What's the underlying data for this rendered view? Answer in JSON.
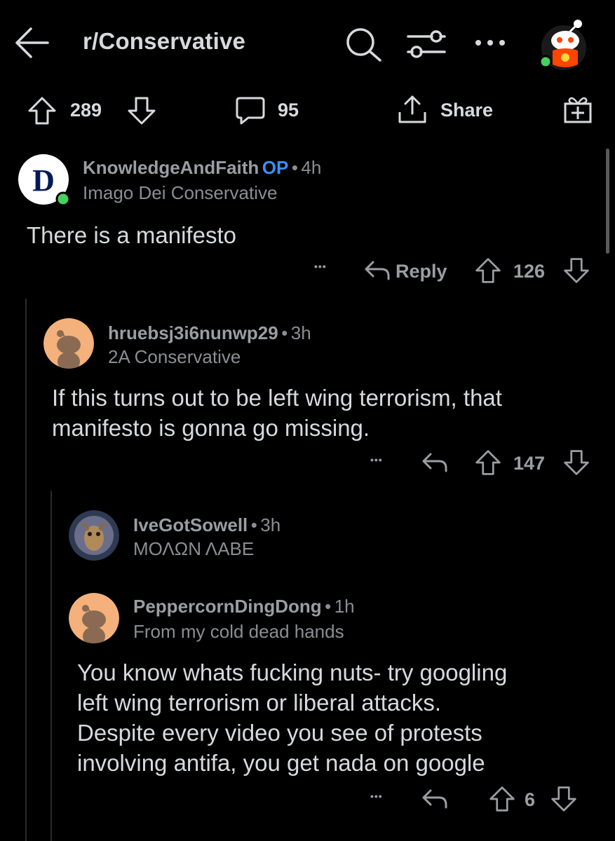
{
  "header": {
    "title": "r/Conservative"
  },
  "post_actions": {
    "upvotes": "289",
    "comments": "95",
    "share_label": "Share"
  },
  "comments": [
    {
      "username": "KnowledgeAndFaith",
      "op_badge": "OP",
      "separator": "•",
      "age": "4h",
      "flair": "Imago Dei Conservative",
      "body": "There is a manifesto",
      "reply_label": "Reply",
      "votes": "126",
      "more": "•••"
    },
    {
      "username": "hruebsj3i6nunwp29",
      "separator": "•",
      "age": "3h",
      "flair": "2A Conservative",
      "body_lines": [
        "If this turns out to be left wing terrorism, that",
        "manifesto is gonna go missing."
      ],
      "votes": "147",
      "more": "•••"
    },
    {
      "username": "IveGotSowell",
      "separator": "•",
      "age": "3h",
      "flair": "ΜΟΛΩΝ ΛΑΒΕ"
    },
    {
      "username": "PeppercornDingDong",
      "separator": "•",
      "age": "1h",
      "flair": "From my cold dead hands",
      "body_lines": [
        "You know whats fucking nuts- try googling",
        "left wing terrorism or liberal attacks.",
        "Despite every video you see of protests",
        "involving antifa, you get nada on google"
      ],
      "votes": "6",
      "more": "•••"
    }
  ],
  "colors": {
    "background": "#000000",
    "text": "#d7dadc",
    "muted": "#8a8e92",
    "op_blue": "#3d8ef7",
    "online_green": "#46d160",
    "reddit_orange": "#ff4500"
  }
}
